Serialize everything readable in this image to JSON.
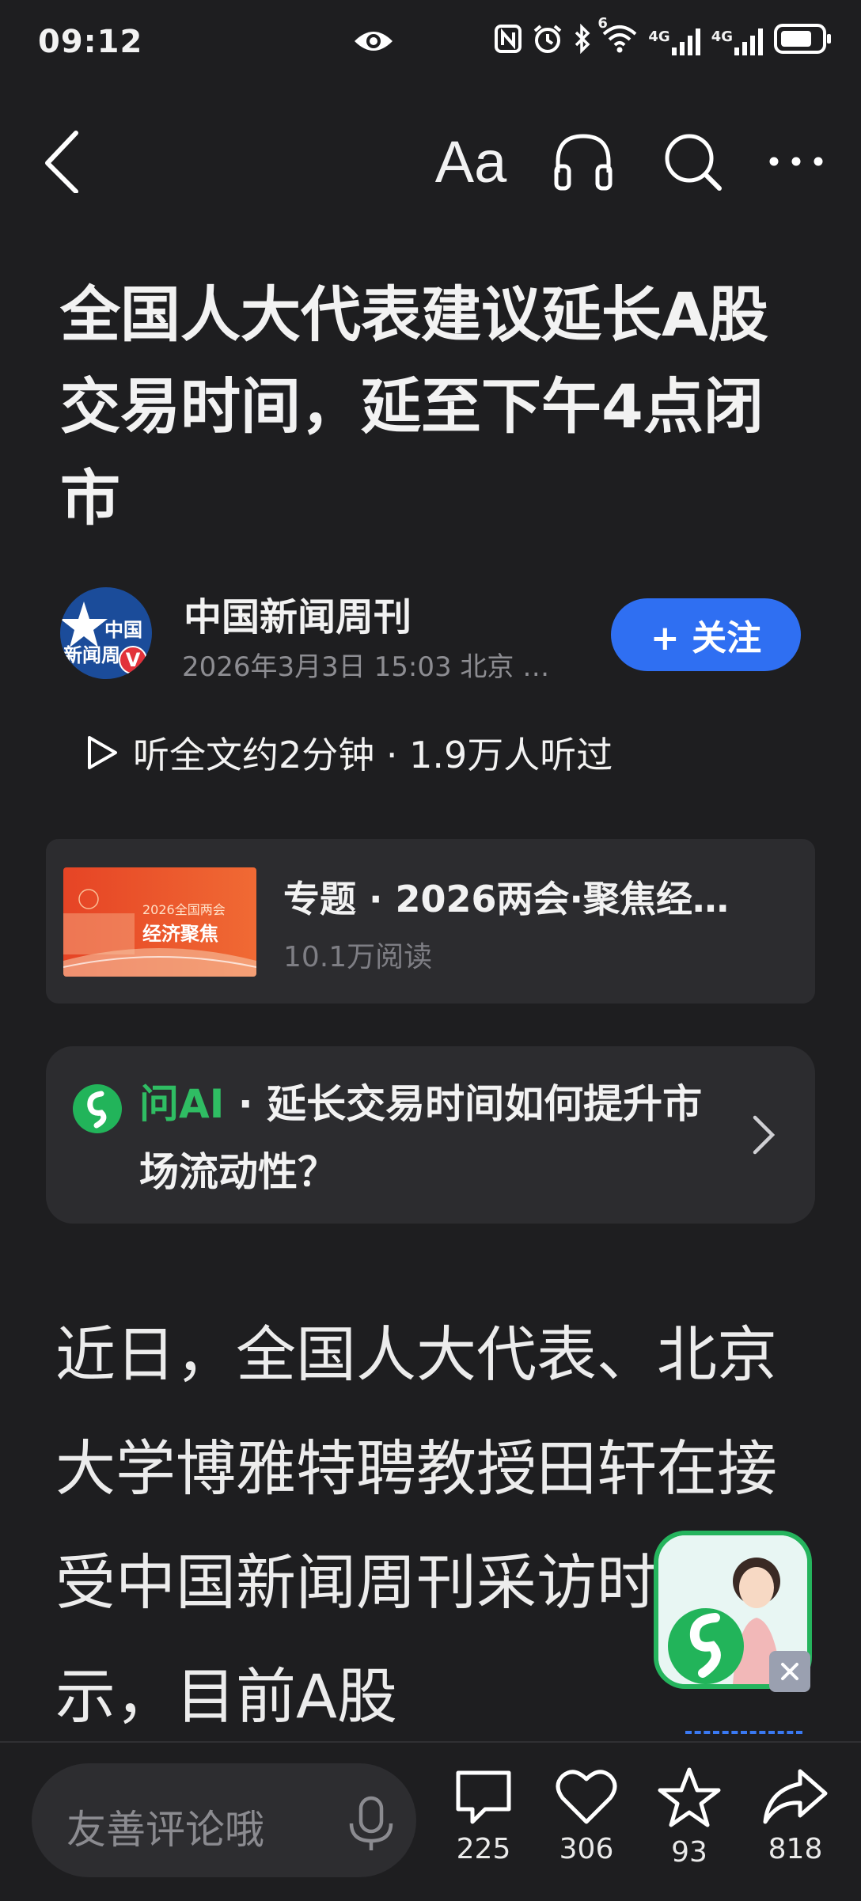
{
  "status_bar": {
    "time": "09:12",
    "network_1": "4G",
    "network_2": "4G",
    "wifi_badge": "6"
  },
  "toolbar": {
    "font_size_label": "Aa"
  },
  "article": {
    "title": "全国人大代表建议延长A股交易时间，延至下午4点闭市",
    "author": {
      "name": "中国新闻周刊",
      "meta": "2026年3月3日 15:03 北京 …",
      "avatar_text_1": "中国",
      "avatar_text_2": "新闻周"
    },
    "follow_label": "+ 关注",
    "listen_text": "听全文约2分钟 · 1.9万人听过",
    "body": "近日，全国人大代表、北京大学博雅特聘教授田轩在接受中国新闻周刊采访时表示，目前A股"
  },
  "topic_card": {
    "image_caption_1": "2026全国两会",
    "image_caption_2": "经济聚焦",
    "title": "专题 · 2026两会·聚焦经…",
    "reads": "10.1万阅读"
  },
  "ai_card": {
    "brand": "问AI",
    "question": " · 延长交易时间如何提升市场流动性？"
  },
  "bottom_bar": {
    "comment_placeholder": "友善评论哦",
    "comments": "225",
    "likes": "306",
    "favorites": "93",
    "shares": "818"
  },
  "colors": {
    "background": "#1e1e20",
    "card": "#2c2c2f",
    "accent_blue": "#2f6ff2",
    "ai_green": "#2fbd63"
  }
}
